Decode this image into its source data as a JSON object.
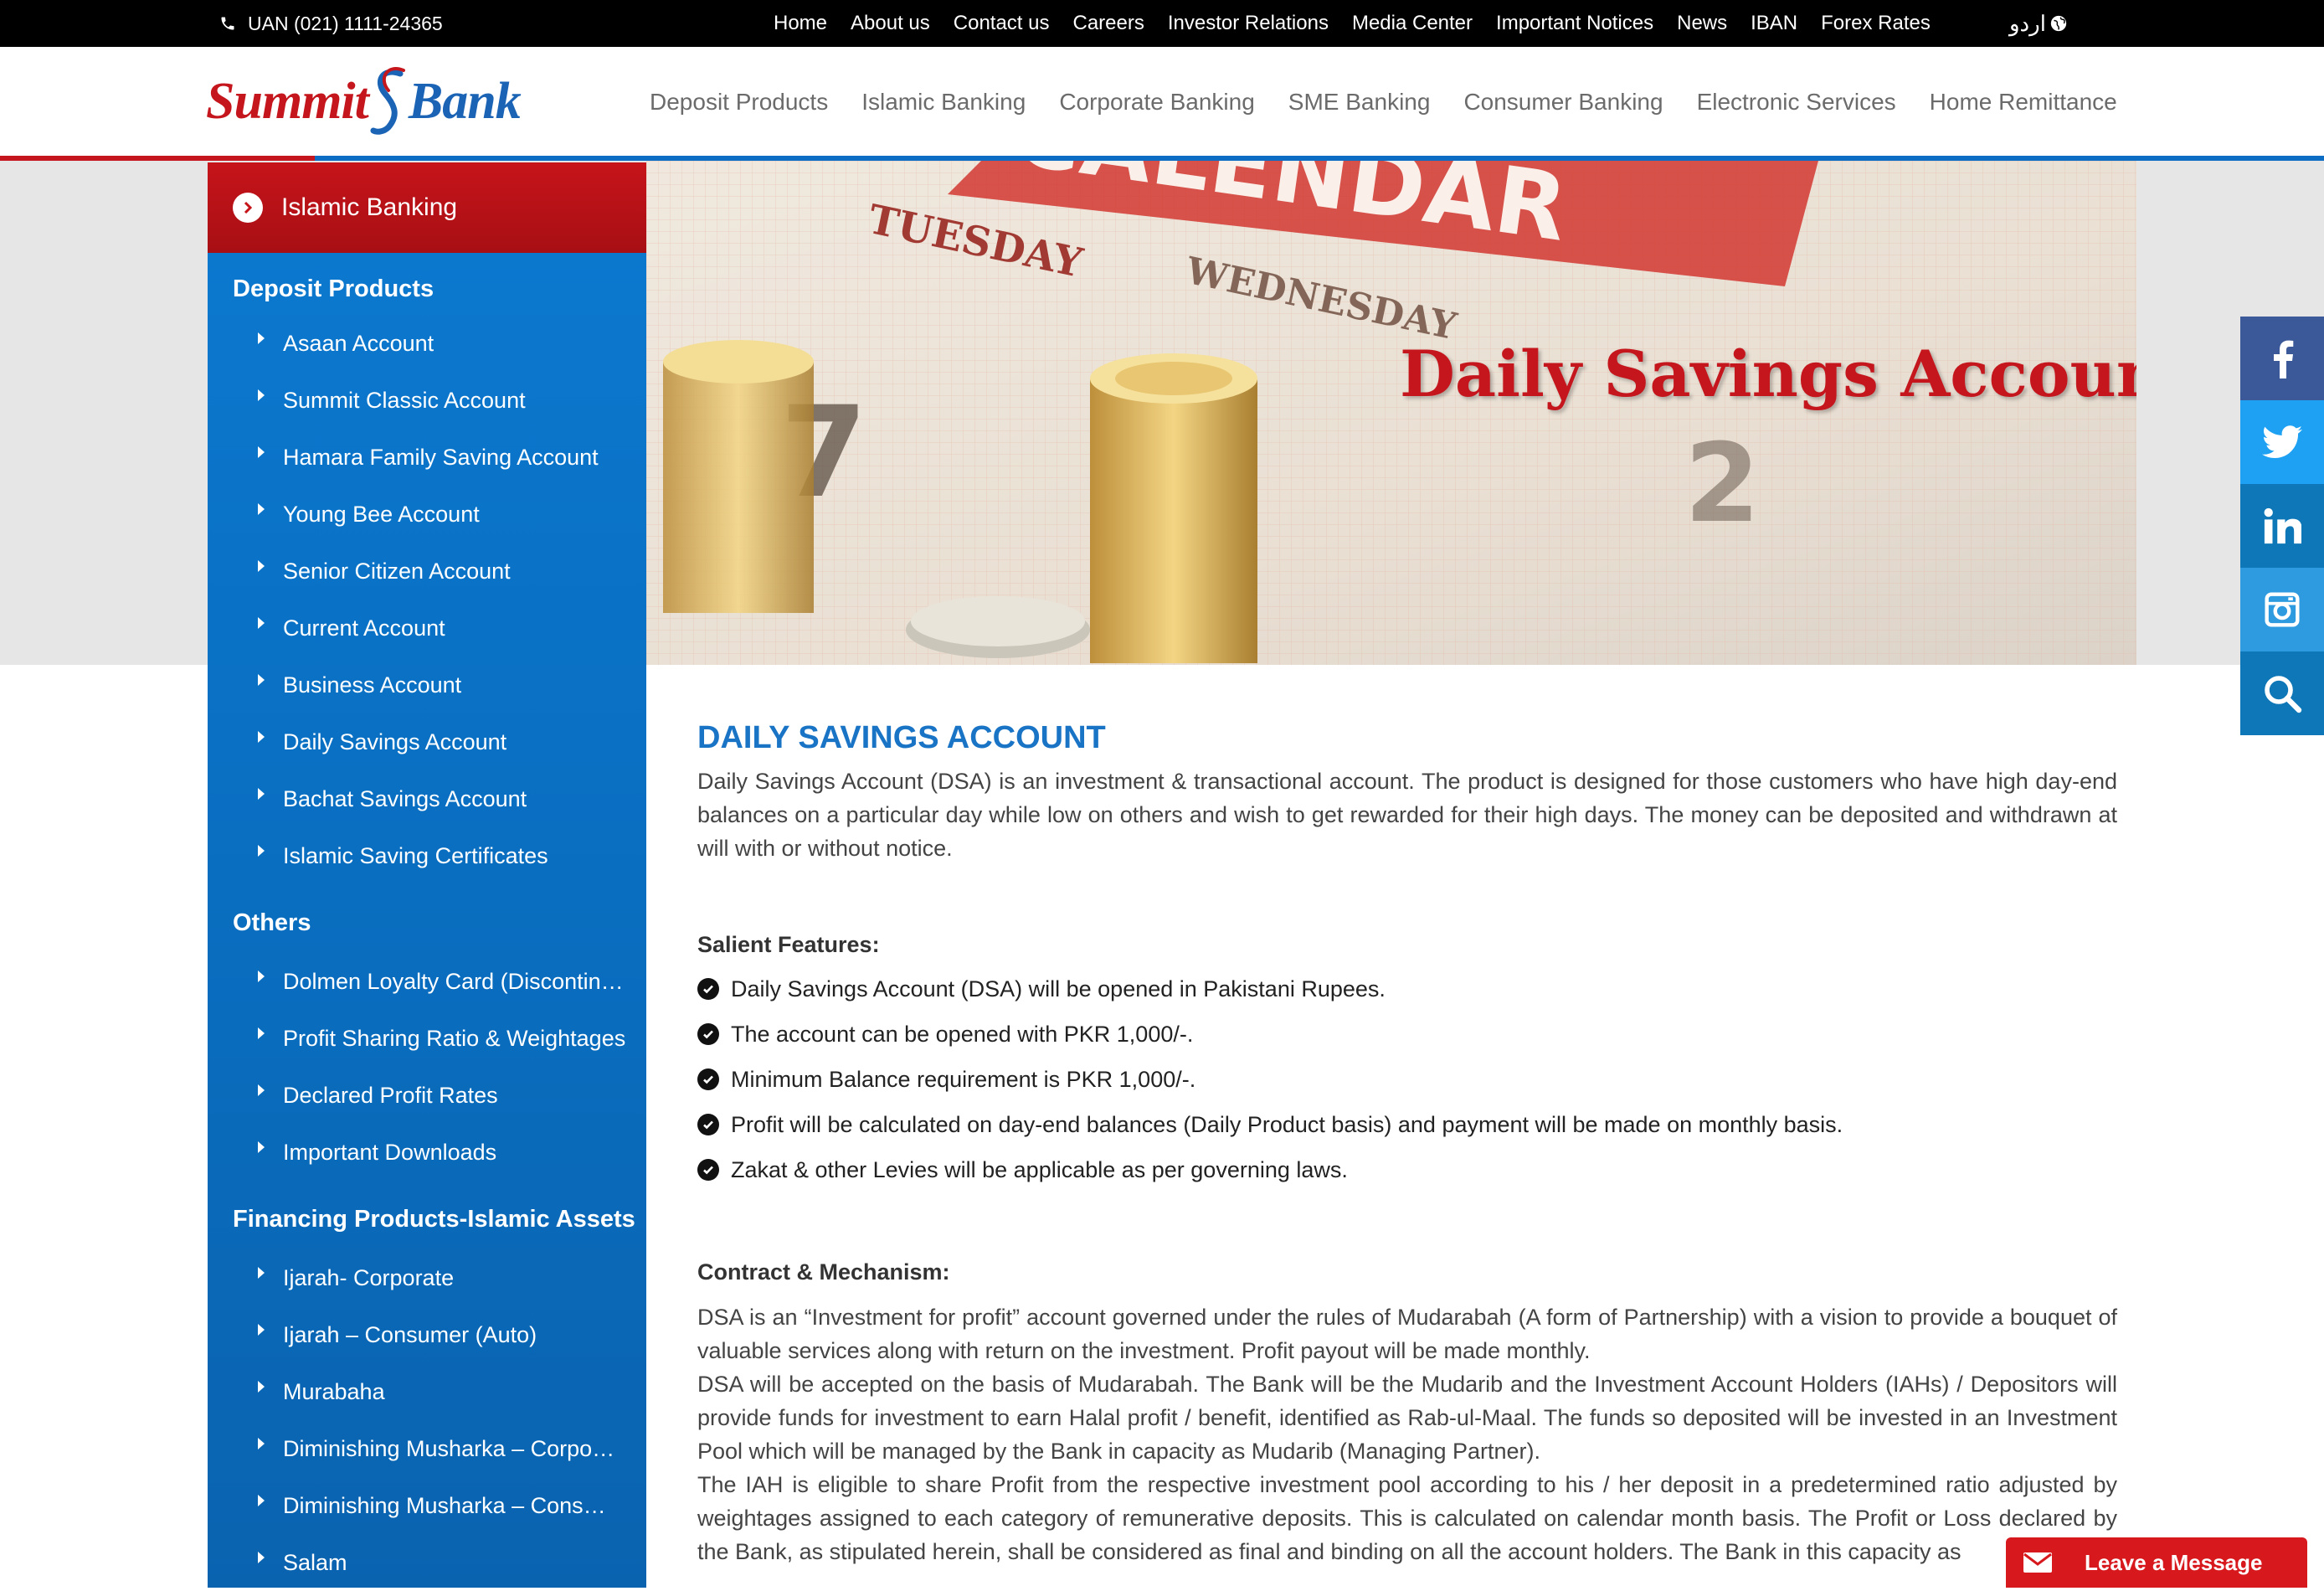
{
  "topbar": {
    "uan": "UAN (021) 1111-24365",
    "links": [
      "Home",
      "About us",
      "Contact us",
      "Careers",
      "Investor Relations",
      "Media Center",
      "Important Notices",
      "News",
      "IBAN",
      "Forex Rates"
    ],
    "language": "اردو"
  },
  "logo": {
    "word1": "Summit",
    "word2": "Bank"
  },
  "main_nav": [
    "Deposit Products",
    "Islamic Banking",
    "Corporate Banking",
    "SME Banking",
    "Consumer Banking",
    "Electronic Services",
    "Home Remittance"
  ],
  "banner": {
    "title": "Daily Savings Account",
    "calendar_text": "CALENDAR",
    "day1": "TUESDAY",
    "day2": "WEDNESDAY"
  },
  "sidebar": {
    "heading": "Islamic Banking",
    "groups": [
      {
        "title": "Deposit Products",
        "items": [
          "Asaan Account",
          "Summit Classic Account",
          "Hamara Family Saving Account",
          "Young Bee Account",
          "Senior Citizen Account",
          "Current Account",
          "Business Account",
          "Daily Savings Account",
          "Bachat Savings Account",
          "Islamic Saving Certificates"
        ]
      },
      {
        "title": "Others",
        "items": [
          "Dolmen Loyalty Card (Discontinued)",
          "Profit Sharing Ratio & Weightages",
          "Declared Profit Rates",
          "Important Downloads"
        ]
      },
      {
        "title": "Financing Products-Islamic Assets",
        "items": [
          "Ijarah- Corporate",
          "Ijarah – Consumer (Auto)",
          "Murabaha",
          "Diminishing Musharka – Corporate",
          "Diminishing Musharka – Consumer",
          "Salam"
        ]
      }
    ]
  },
  "social": [
    "facebook-icon",
    "twitter-icon",
    "linkedin-icon",
    "instagram-icon",
    "search-icon"
  ],
  "content": {
    "heading": "DAILY SAVINGS ACCOUNT",
    "intro": "Daily Savings Account (DSA) is an investment & transactional account. The product is designed for those customers who have high day-end balances on a particular day while low on others and wish to get rewarded for their high days. The money can be deposited and withdrawn at will with or without notice.",
    "features_title": "Salient Features:",
    "features": [
      "Daily Savings Account (DSA) will be opened in Pakistani Rupees.",
      "The account can be opened with PKR 1,000/-.",
      "Minimum Balance requirement is PKR 1,000/-.",
      "Profit will be calculated on day-end balances (Daily Product basis) and payment will be made on monthly basis.",
      "Zakat & other Levies will be applicable as per governing laws."
    ],
    "contract_title": "Contract & Mechanism:",
    "contract_p1": "DSA is an “Investment for profit” account governed under the rules of Mudarabah (A form of Partnership) with a vision to provide a bouquet of valuable services along with return on the investment. Profit payout will be made monthly.",
    "contract_p2": "DSA will be accepted on the basis of Mudarabah. The Bank will be the Mudarib and the Investment Account Holders (IAHs) / Depositors will provide funds for investment to earn Halal profit / benefit, identified as Rab-ul-Maal. The funds so deposited will be invested in an Investment Pool which will be managed by the Bank in capacity as Mudarib (Managing Partner).",
    "contract_p3": "The IAH is eligible to share Profit from the respective investment pool according to his / her deposit in a predetermined ratio adjusted by weightages assigned to each category of remunerative deposits. This is calculated on calendar month basis. The Profit or Loss declared by the Bank, as stipulated herein, shall be considered as final and binding on all the account holders. The Bank in this capacity as"
  },
  "leave_message": "Leave a Message"
}
